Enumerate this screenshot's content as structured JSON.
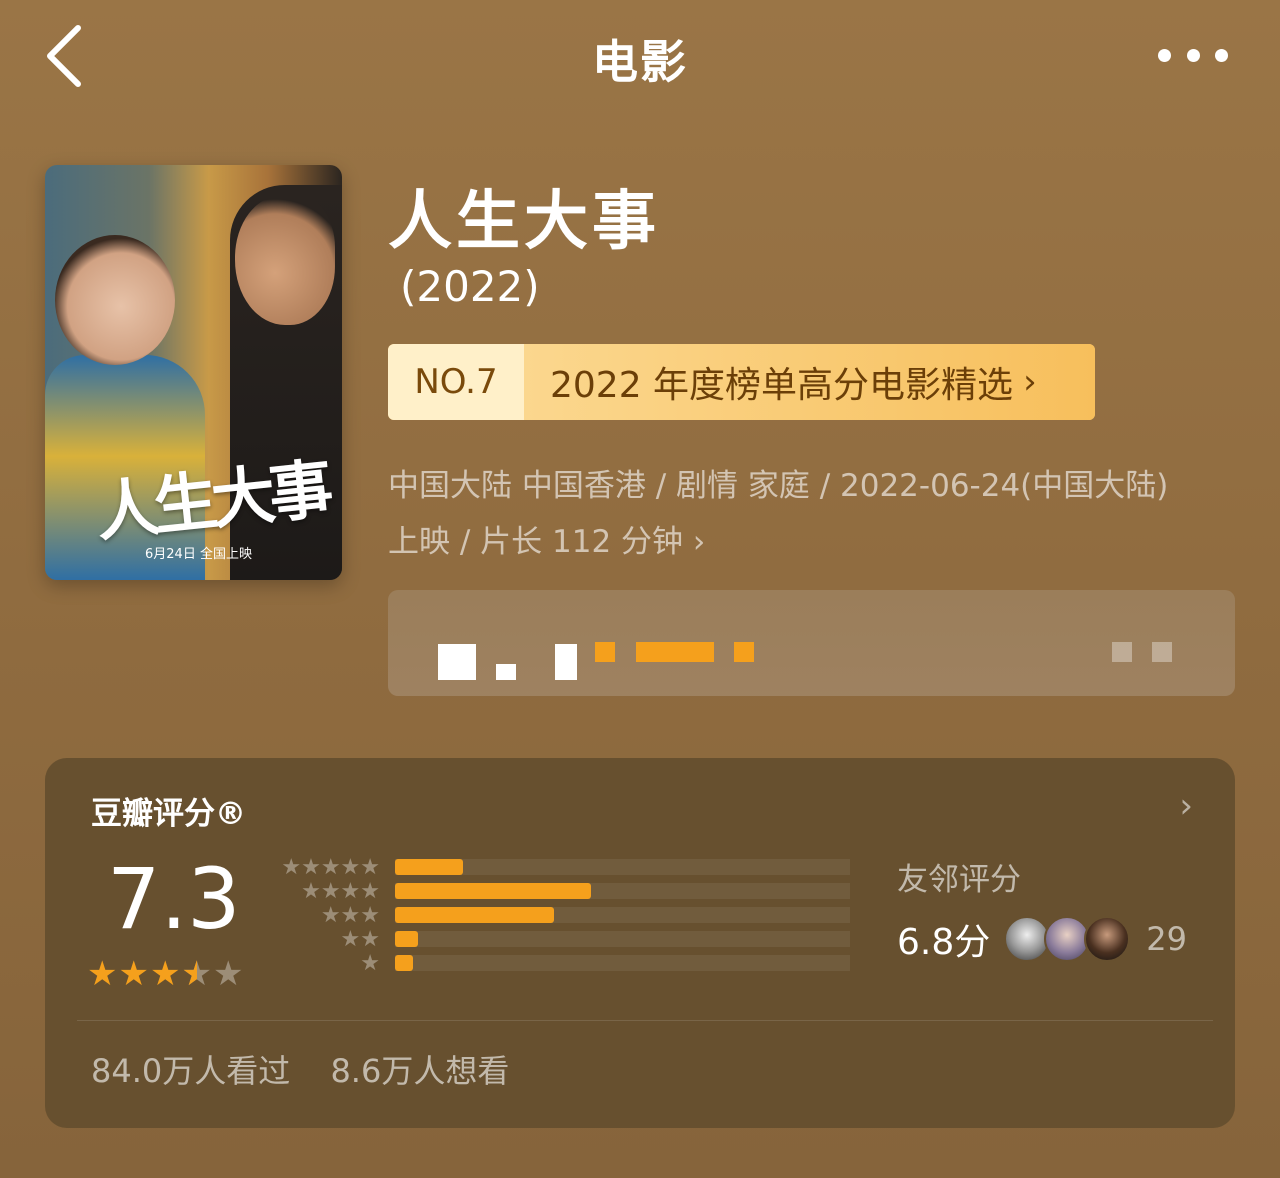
{
  "nav": {
    "title": "电影",
    "back_icon": "chevron-left-icon",
    "more_icon": "more-dots-icon"
  },
  "poster": {
    "title_text": "人生大事",
    "release_text": "6月24日 全国上映"
  },
  "movie": {
    "title": "人生大事",
    "year": "(2022)",
    "rank": {
      "no": "NO.7",
      "list": "2022 年度榜单高分电影精选"
    },
    "info_line1": "中国大陆 中国香港 / 剧情 家庭 / 2022-06-24(中国大陆)",
    "info_line2": "上映 / 片长 112 分钟"
  },
  "rating": {
    "label": "豆瓣评分®",
    "score": "7.3",
    "stars_value": 3.5,
    "distribution": [
      {
        "stars": "★★★★★",
        "fraction": 0.15
      },
      {
        "stars": "★★★★",
        "fraction": 0.43
      },
      {
        "stars": "★★★",
        "fraction": 0.35
      },
      {
        "stars": "★★",
        "fraction": 0.05
      },
      {
        "stars": "★",
        "fraction": 0.04
      }
    ],
    "friends_label": "友邻评分",
    "friends_score": "6.8分",
    "friends_count": "29",
    "watched": "84.0万人看过",
    "wish": "8.6万人想看"
  },
  "colors": {
    "accent": "#f5a01c",
    "background": "#8f6b3f",
    "card": "#67502f"
  }
}
